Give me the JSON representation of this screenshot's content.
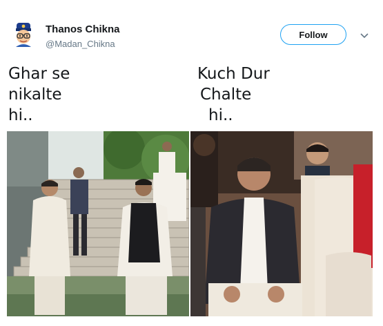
{
  "tweet": {
    "user": {
      "name": "Thanos Chikna",
      "handle": "@Madan_Chikna",
      "avatar_icon": "cartoon-avatar-icon"
    },
    "follow_label": "Follow",
    "menu_icon": "chevron-down-icon",
    "left_caption": [
      "Ghar se",
      "nikalte",
      "hi.."
    ],
    "right_caption": [
      "Kuch Dur",
      "Chalte",
      "hi.."
    ]
  },
  "colors": {
    "accent": "#1da1f2",
    "text": "#14171a",
    "muted": "#657786"
  }
}
